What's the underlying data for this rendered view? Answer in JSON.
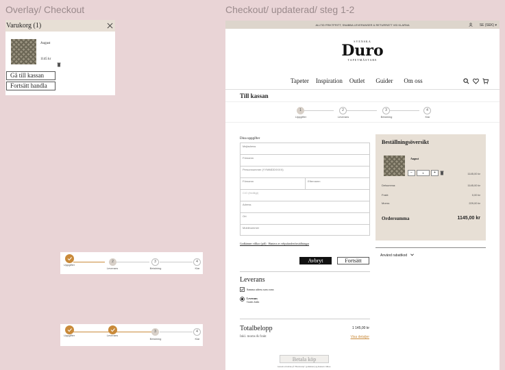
{
  "frame_titles": {
    "left": "Overlay/ Checkout",
    "right": "Checkout/ updaterad/ steg 1-2"
  },
  "cart_overlay": {
    "title": "Varukorg (1)",
    "item_name": "August",
    "item_price": "1145 kr",
    "go_to_checkout": "Gå till kassan",
    "continue_shopping": "Fortsätt handla"
  },
  "stepper_a": {
    "steps": [
      {
        "num": "",
        "label": "Uppgifter",
        "state": "done"
      },
      {
        "num": "2",
        "label": "Leverans",
        "state": "active"
      },
      {
        "num": "3",
        "label": "Betalning",
        "state": "todo"
      },
      {
        "num": "4",
        "label": "Klar",
        "state": "todo"
      }
    ]
  },
  "stepper_b": {
    "steps": [
      {
        "num": "",
        "label": "Uppgifter",
        "state": "done"
      },
      {
        "num": "",
        "label": "Leverans",
        "state": "done"
      },
      {
        "num": "3",
        "label": "Betalning",
        "state": "active"
      },
      {
        "num": "4",
        "label": "Klar",
        "state": "todo"
      }
    ]
  },
  "checkout": {
    "banner": "ALLTID FRIKTFRITT, SNABBA LEVERANSER & RETURRÄTT VID KLARNA",
    "currency": "SE (SEK)",
    "logo_top": "SVENSKA",
    "logo_main": "Duro",
    "logo_bottom": "TAPETMÄSTARE",
    "nav": [
      "Tapeter",
      "Inspiration",
      "Outlet",
      "Guider",
      "Om oss"
    ],
    "page_heading": "Till kassan",
    "steps": [
      {
        "num": "1",
        "label": "Uppgifter"
      },
      {
        "num": "2",
        "label": "Leverans"
      },
      {
        "num": "3",
        "label": "Betalning"
      },
      {
        "num": "4",
        "label": "Klar"
      }
    ],
    "form": {
      "heading": "Dina uppgifter",
      "fields": [
        "Mejladress",
        "Förnamn",
        "Personnummer (YYMMDDXXXX)"
      ],
      "first_name": "Förnamn",
      "last_name": "Efternamn",
      "fields2": [
        "C/O (frivilligt)",
        "Adress",
        "Ort",
        "Mobilnummer"
      ],
      "terms": "Godkänner villkor (pdf) · Hantera av erbjudanden/inställningar",
      "cancel": "Avbryt",
      "continue": "Fortsätt"
    },
    "delivery": {
      "heading": "Leverans",
      "same_address": "Samma adress som ovan",
      "option_name": "Leverans",
      "option_sub": "Gratis frakt"
    },
    "total": {
      "heading": "Totalbelopp",
      "sub": "Inkl. moms & frakt",
      "amount": "1 145,00 kr",
      "details_link": "Visa detaljer",
      "pay_button": "Betala köp",
      "footer": "Genom att klicka på \"Betala köp\" godkänner jag Kunsets villkor."
    },
    "summary": {
      "heading": "Beställningsöversikt",
      "item_name": "August",
      "qty": "1",
      "item_price": "1145,00 kr",
      "rows": [
        {
          "label": "Delsumma:",
          "value": "1145,00 kr"
        },
        {
          "label": "Frakt:",
          "value": "0,00 kr"
        },
        {
          "label": "Moms:",
          "value": "229,00 kr"
        }
      ],
      "order_total_label": "Ordersumma",
      "order_total_value": "1145,00 kr",
      "discount": "Använd rabattkod"
    }
  }
}
